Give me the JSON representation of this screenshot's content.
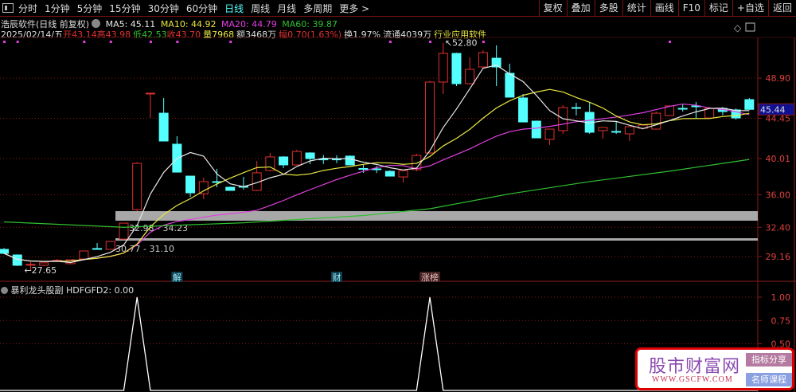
{
  "toolbar": {
    "periods": [
      "分时",
      "1分钟",
      "5分钟",
      "15分钟",
      "30分钟",
      "60分钟",
      "日线",
      "周线",
      "月线",
      "多周期",
      "更多 >"
    ],
    "active_period": "日线",
    "right_buttons": [
      "复权",
      "叠加",
      "多股",
      "统计",
      "画线",
      "F10",
      "标记",
      "+自选",
      "返回"
    ]
  },
  "info": {
    "title": "浩辰软件(日线 前复权)",
    "ma5": "MA5: 45.11",
    "ma10": "MA10: 44.92",
    "ma20": "MA20: 44.79",
    "ma60": "MA60: 39.87",
    "date": "2025/02/14/五",
    "open": "开43.14",
    "high": "高43.98",
    "low": "低42.53",
    "close": "收43.70",
    "volume": "量7968",
    "amount": "额3468万",
    "change": "幅0.70(1.63%)",
    "turnover": "换1.97%",
    "float": "流通4039万",
    "industry": "行业应用软件"
  },
  "colors": {
    "up": "#e03030",
    "down": "#54ffff",
    "ma5": "#e8e8e8",
    "ma10": "#e8e840",
    "ma20": "#e040e0",
    "ma60": "#30c030",
    "grid": "#8a1a1a",
    "axis": "#e04040"
  },
  "price_axis": {
    "ticks": [
      "48.90",
      "44.45",
      "40.01",
      "36.00",
      "32.40",
      "29.16"
    ],
    "tick_values": [
      48.9,
      44.45,
      40.01,
      36.0,
      32.4,
      29.16
    ],
    "range": [
      26.77,
      52.7
    ],
    "current": "45.44"
  },
  "annotations": {
    "high_label": "52.80",
    "low_label": "27.65",
    "zone1": "32.98 - 34.23",
    "zone2": "30.77 - 31.10",
    "zone1_range": [
      32.98,
      34.23
    ],
    "zone2_range": [
      30.77,
      31.1
    ],
    "markers": [
      {
        "text": "解",
        "index": 13
      },
      {
        "text": "财",
        "index": 25
      },
      {
        "text": "涨榜",
        "index": 32
      }
    ]
  },
  "dots_indices": [
    0,
    1,
    6,
    8,
    11,
    13,
    17,
    29,
    32,
    36,
    50
  ],
  "candles": [
    [
      29.96,
      30.1,
      29.45,
      29.52
    ],
    [
      29.34,
      29.4,
      28.11,
      28.2
    ],
    [
      28.25,
      28.64,
      27.65,
      28.3
    ],
    [
      28.2,
      28.47,
      28.1,
      28.47
    ],
    [
      28.7,
      28.9,
      28.55,
      28.75
    ],
    [
      28.38,
      28.85,
      28.3,
      28.81
    ],
    [
      28.9,
      29.78,
      28.85,
      29.78
    ],
    [
      30.05,
      30.66,
      29.95,
      30.0
    ],
    [
      29.96,
      30.84,
      29.9,
      30.84
    ],
    [
      31.1,
      32.86,
      31.0,
      32.86
    ],
    [
      34.36,
      39.6,
      34.2,
      39.47
    ],
    [
      47.15,
      47.23,
      44.49,
      47.23
    ],
    [
      45.02,
      46.7,
      41.94,
      41.94
    ],
    [
      41.59,
      42.47,
      38.5,
      38.5
    ],
    [
      38.06,
      38.06,
      35.77,
      36.21
    ],
    [
      36.12,
      37.89,
      35.51,
      37.45
    ],
    [
      37.45,
      38.86,
      36.83,
      37.4
    ],
    [
      36.83,
      36.9,
      36.48,
      36.48
    ],
    [
      36.92,
      37.97,
      36.57,
      36.9
    ],
    [
      36.48,
      39.74,
      36.4,
      38.42
    ],
    [
      38.68,
      40.62,
      38.6,
      40.18
    ],
    [
      40.18,
      40.27,
      38.94,
      39.3
    ],
    [
      39.3,
      40.97,
      39.25,
      40.79
    ],
    [
      40.62,
      40.7,
      39.38,
      40.0
    ],
    [
      39.95,
      40.4,
      39.4,
      39.9
    ],
    [
      39.95,
      40.35,
      39.5,
      39.91
    ],
    [
      40.27,
      40.35,
      39.3,
      39.3
    ],
    [
      38.9,
      39.3,
      38.42,
      38.86
    ],
    [
      38.86,
      39.2,
      38.4,
      38.8
    ],
    [
      38.59,
      38.7,
      38.06,
      38.06
    ],
    [
      37.97,
      38.7,
      37.36,
      38.68
    ],
    [
      38.77,
      40.53,
      38.59,
      40.35
    ],
    [
      40.62,
      48.6,
      40.5,
      48.46
    ],
    [
      48.46,
      52.8,
      47.14,
      51.63
    ],
    [
      51.63,
      51.7,
      48.02,
      48.28
    ],
    [
      48.28,
      51.19,
      48.2,
      49.87
    ],
    [
      50.13,
      51.98,
      50.05,
      51.72
    ],
    [
      51.1,
      52.51,
      48.02,
      50.13
    ],
    [
      49.43,
      50.49,
      46.79,
      46.79
    ],
    [
      46.7,
      47.14,
      44.05,
      44.05
    ],
    [
      44.14,
      44.2,
      42.29,
      42.29
    ],
    [
      42.12,
      43.26,
      41.5,
      43.26
    ],
    [
      43.09,
      45.9,
      42.73,
      45.64
    ],
    [
      45.64,
      46.17,
      44.76,
      45.6
    ],
    [
      45.11,
      46.26,
      42.73,
      42.91
    ],
    [
      43.09,
      43.44,
      42.2,
      43.44
    ],
    [
      43.0,
      44.14,
      42.73,
      42.95
    ],
    [
      42.73,
      43.53,
      41.94,
      43.53
    ],
    [
      43.35,
      43.7,
      43.2,
      43.7
    ],
    [
      43.26,
      45.2,
      43.2,
      45.02
    ],
    [
      44.76,
      45.82,
      44.7,
      45.82
    ],
    [
      45.55,
      46.0,
      45.2,
      45.5
    ],
    [
      45.82,
      46.26,
      44.49,
      45.8
    ],
    [
      44.49,
      45.72,
      44.4,
      45.55
    ],
    [
      45.55,
      45.7,
      44.8,
      45.2
    ],
    [
      45.38,
      45.55,
      44.3,
      44.49
    ],
    [
      46.52,
      46.7,
      45.38,
      45.44
    ]
  ],
  "ma60_points": [
    [
      0,
      33.0
    ],
    [
      9,
      32.4
    ],
    [
      18,
      32.9
    ],
    [
      27,
      33.7
    ],
    [
      32,
      34.45
    ],
    [
      38,
      36.1
    ],
    [
      44,
      37.45
    ],
    [
      50,
      38.6
    ],
    [
      56,
      39.9
    ]
  ],
  "sub_indicator": {
    "label": "暴利龙头股副",
    "value": "HDFGFD2: 0.00",
    "ticks": [
      "1.00",
      "0.75",
      "0.50"
    ],
    "tick_values": [
      1.0,
      0.75,
      0.5
    ],
    "peaks": [
      10,
      32
    ]
  },
  "watermark": {
    "title": "股市财富网",
    "url": "WWW.GSCFW.COM",
    "tag1": "指标分享",
    "tag2": "名师课程"
  }
}
